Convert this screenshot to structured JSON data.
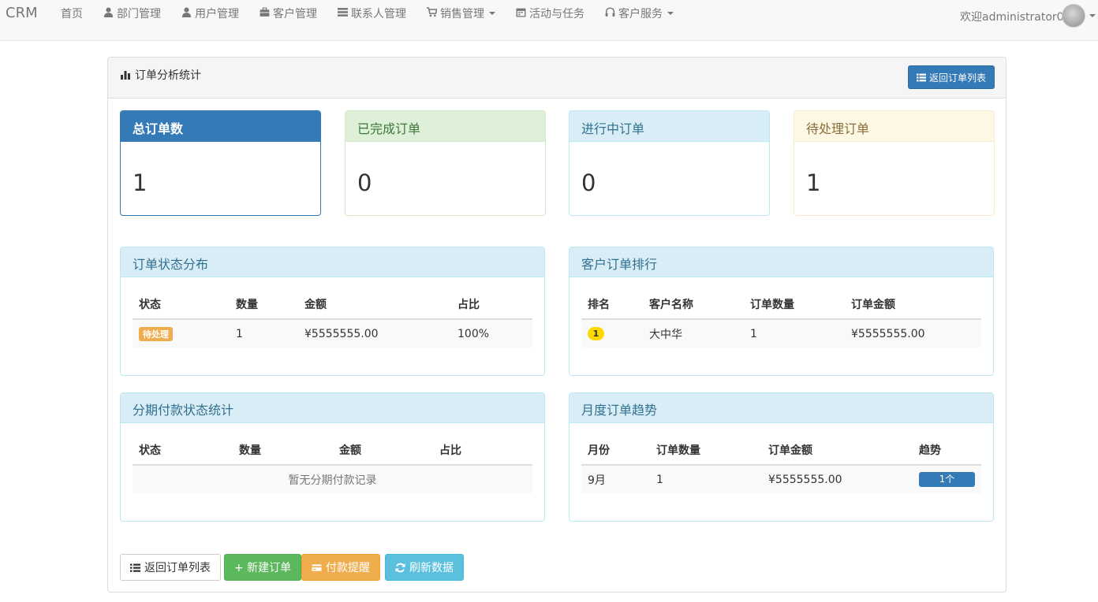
{
  "navbar": {
    "brand": "CRM",
    "items": [
      {
        "label": "首页",
        "icon": "",
        "dropdown": false
      },
      {
        "label": "部门管理",
        "icon": "user-icon",
        "dropdown": false
      },
      {
        "label": "用户管理",
        "icon": "user-icon",
        "dropdown": false
      },
      {
        "label": "客户管理",
        "icon": "briefcase-icon",
        "dropdown": false
      },
      {
        "label": "联系人管理",
        "icon": "list-icon",
        "dropdown": false
      },
      {
        "label": "销售管理",
        "icon": "cart-icon",
        "dropdown": true
      },
      {
        "label": "活动与任务",
        "icon": "calendar-icon",
        "dropdown": false
      },
      {
        "label": "客户服务",
        "icon": "headphones-icon",
        "dropdown": true
      }
    ],
    "welcome": "欢迎administrator0"
  },
  "page": {
    "title": "订单分析统计",
    "back_top_label": "返回订单列表"
  },
  "stats": [
    {
      "title": "总订单数",
      "value": "1",
      "style": "primary"
    },
    {
      "title": "已完成订单",
      "value": "0",
      "style": "success"
    },
    {
      "title": "进行中订单",
      "value": "0",
      "style": "info"
    },
    {
      "title": "待处理订单",
      "value": "1",
      "style": "warning"
    }
  ],
  "status_dist": {
    "title": "订单状态分布",
    "headers": [
      "状态",
      "数量",
      "金额",
      "占比"
    ],
    "rows": [
      {
        "status": "待处理",
        "count": "1",
        "amount": "¥5555555.00",
        "ratio": "100%"
      }
    ]
  },
  "customer_rank": {
    "title": "客户订单排行",
    "headers": [
      "排名",
      "客户名称",
      "订单数量",
      "订单金额"
    ],
    "rows": [
      {
        "rank": "1",
        "name": "大中华",
        "count": "1",
        "amount": "¥5555555.00"
      }
    ]
  },
  "installment": {
    "title": "分期付款状态统计",
    "headers": [
      "状态",
      "数量",
      "金额",
      "占比"
    ],
    "empty": "暂无分期付款记录"
  },
  "monthly": {
    "title": "月度订单趋势",
    "headers": [
      "月份",
      "订单数量",
      "订单金额",
      "趋势"
    ],
    "rows": [
      {
        "month": "9月",
        "count": "1",
        "amount": "¥5555555.00",
        "trend": "1个"
      }
    ]
  },
  "actions": {
    "back": "返回订单列表",
    "new": "+ 新建订单",
    "remind": "付款提醒",
    "refresh": "刷新数据"
  },
  "colors": {
    "primary": "#337ab7",
    "success": "#5cb85c",
    "warning": "#f0ad4e",
    "info": "#5bc0de",
    "rank_gold": "#ffd700"
  }
}
